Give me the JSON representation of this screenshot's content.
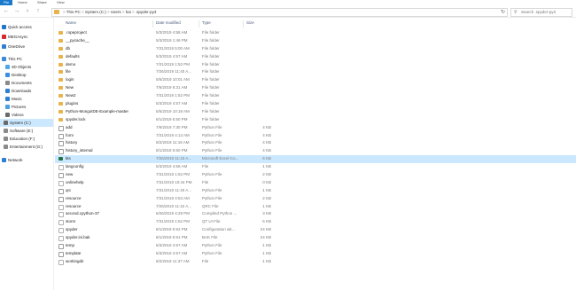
{
  "ribbon": {
    "file": "File",
    "tabs": [
      "Home",
      "Share",
      "View"
    ]
  },
  "address": {
    "path": [
      "This PC",
      "System (C:)",
      "Users",
      "hai",
      ".spyder-py3"
    ],
    "separator": ">",
    "search_placeholder": "Search .spyder-py3"
  },
  "nav": {
    "items": [
      {
        "label": "Quick access",
        "icon": "star-icon",
        "color": "#1f76c9"
      },
      {
        "label": "MEGAsync",
        "icon": "mega-icon",
        "color": "#d9272e"
      },
      {
        "label": "OneDrive",
        "icon": "cloud-icon",
        "color": "#2d7fd3"
      },
      {
        "label": "This PC",
        "icon": "computer-icon",
        "color": "#3c8ad8"
      },
      {
        "label": "3D Objects",
        "icon": "cube-icon",
        "color": "#4fa7e8"
      },
      {
        "label": "Desktop",
        "icon": "desktop-icon",
        "color": "#3a8ee0"
      },
      {
        "label": "Documents",
        "icon": "documents-icon",
        "color": "#8a8a8a"
      },
      {
        "label": "Downloads",
        "icon": "download-icon",
        "color": "#2d7fd3"
      },
      {
        "label": "Music",
        "icon": "music-icon",
        "color": "#2d7fd3"
      },
      {
        "label": "Pictures",
        "icon": "pictures-icon",
        "color": "#4aa0e0"
      },
      {
        "label": "Videos",
        "icon": "videos-icon",
        "color": "#6a6a6a"
      },
      {
        "label": "System (C:)",
        "icon": "drive-icon",
        "color": "#6a6a6a"
      },
      {
        "label": "Software (E:)",
        "icon": "drive-icon",
        "color": "#8a8a8a"
      },
      {
        "label": "Education (F:)",
        "icon": "drive-icon",
        "color": "#8a8a8a"
      },
      {
        "label": "Entertainment (G:)",
        "icon": "drive-icon",
        "color": "#8a8a8a"
      },
      {
        "label": "Network",
        "icon": "network-icon",
        "color": "#2d7fd3"
      }
    ],
    "selected": "System (C:)"
  },
  "columns": {
    "name": "Name",
    "date": "Date modified",
    "type": "Type",
    "size": "Size"
  },
  "files": [
    {
      "name": ".ropeproject",
      "date": "5/3/2019 4:58 AM",
      "type": "File folder",
      "size": "",
      "kind": "folder"
    },
    {
      "name": "__pycache__",
      "date": "5/3/2019 1:46 PM",
      "type": "File folder",
      "size": "",
      "kind": "folder"
    },
    {
      "name": "db",
      "date": "7/31/2019 5:00 AM",
      "type": "File folder",
      "size": "",
      "kind": "folder"
    },
    {
      "name": "defaults",
      "date": "5/3/2019 4:57 AM",
      "type": "File folder",
      "size": "",
      "kind": "folder"
    },
    {
      "name": "demo",
      "date": "7/31/2019 1:52 PM",
      "type": "File folder",
      "size": "",
      "kind": "folder"
    },
    {
      "name": "file",
      "date": "7/26/2019 11:40 A...",
      "type": "File folder",
      "size": "",
      "kind": "folder"
    },
    {
      "name": "login",
      "date": "5/5/2019 10:01 AM",
      "type": "File folder",
      "size": "",
      "kind": "folder"
    },
    {
      "name": "New",
      "date": "7/6/2019 6:31 AM",
      "type": "File folder",
      "size": "",
      "kind": "folder"
    },
    {
      "name": "New2",
      "date": "7/31/2019 1:52 PM",
      "type": "File folder",
      "size": "",
      "kind": "folder"
    },
    {
      "name": "plugins",
      "date": "5/3/2019 4:57 AM",
      "type": "File folder",
      "size": "",
      "kind": "folder"
    },
    {
      "name": "Python-MongoIDE-Example-master",
      "date": "5/5/2019 10:18 AM",
      "type": "File folder",
      "size": "",
      "kind": "folder"
    },
    {
      "name": "spyder.lock",
      "date": "8/1/2019 5:50 PM",
      "type": "File folder",
      "size": "",
      "kind": "folder"
    },
    {
      "name": "add",
      "date": "7/9/2019 7:30 PM",
      "type": "Python File",
      "size": "4 KB",
      "kind": "py"
    },
    {
      "name": "form",
      "date": "7/31/2019 4:13 AM",
      "type": "Python File",
      "size": "4 KB",
      "kind": "py"
    },
    {
      "name": "history",
      "date": "8/2/2019 11:16 AM",
      "type": "Python File",
      "size": "4 KB",
      "kind": "py"
    },
    {
      "name": "history_internal",
      "date": "8/1/2019 5:50 PM",
      "type": "Python File",
      "size": "4 KB",
      "kind": "py"
    },
    {
      "name": "kts",
      "date": "7/26/2019 11:43 A...",
      "type": "Microsoft Excel Co...",
      "size": "6 KB",
      "kind": "xls"
    },
    {
      "name": "langconfig",
      "date": "5/3/2019 4:58 AM",
      "type": "File",
      "size": "1 KB",
      "kind": "file"
    },
    {
      "name": "new",
      "date": "7/31/2019 1:52 PM",
      "type": "Python File",
      "size": "2 KB",
      "kind": "py"
    },
    {
      "name": "onlinehelp",
      "date": "7/31/2019 10:44 PM",
      "type": "File",
      "size": "0 KB",
      "kind": "file"
    },
    {
      "name": "qrc",
      "date": "7/31/2019 11:40 A...",
      "type": "Python File",
      "size": "1 KB",
      "kind": "py"
    },
    {
      "name": "resource",
      "date": "7/31/2019 4:53 AM",
      "type": "Python File",
      "size": "2 KB",
      "kind": "py"
    },
    {
      "name": "resource",
      "date": "7/25/2019 11:42 A...",
      "type": "QRC File",
      "size": "1 KB",
      "kind": "file"
    },
    {
      "name": "second.cpython-37",
      "date": "6/26/2019 4:29 PM",
      "type": "Compiled Python ...",
      "size": "3 KB",
      "kind": "file"
    },
    {
      "name": "storm",
      "date": "7/31/2019 1:52 PM",
      "type": "QT UI File",
      "size": "6 KB",
      "kind": "file"
    },
    {
      "name": "spyder",
      "date": "8/1/2019 5:52 PM",
      "type": "Configuration wit...",
      "size": "24 KB",
      "kind": "file"
    },
    {
      "name": "spyder.ini.bak",
      "date": "8/1/2019 5:51 PM",
      "type": "BAK File",
      "size": "24 KB",
      "kind": "file"
    },
    {
      "name": "temp",
      "date": "5/3/2019 4:57 AM",
      "type": "Python File",
      "size": "1 KB",
      "kind": "py"
    },
    {
      "name": "template",
      "date": "5/3/2019 4:57 AM",
      "type": "Python File",
      "size": "1 KB",
      "kind": "py"
    },
    {
      "name": "workingdir",
      "date": "8/2/2019 11:37 AM",
      "type": "File",
      "size": "1 KB",
      "kind": "file"
    }
  ],
  "selected_file": "kts"
}
